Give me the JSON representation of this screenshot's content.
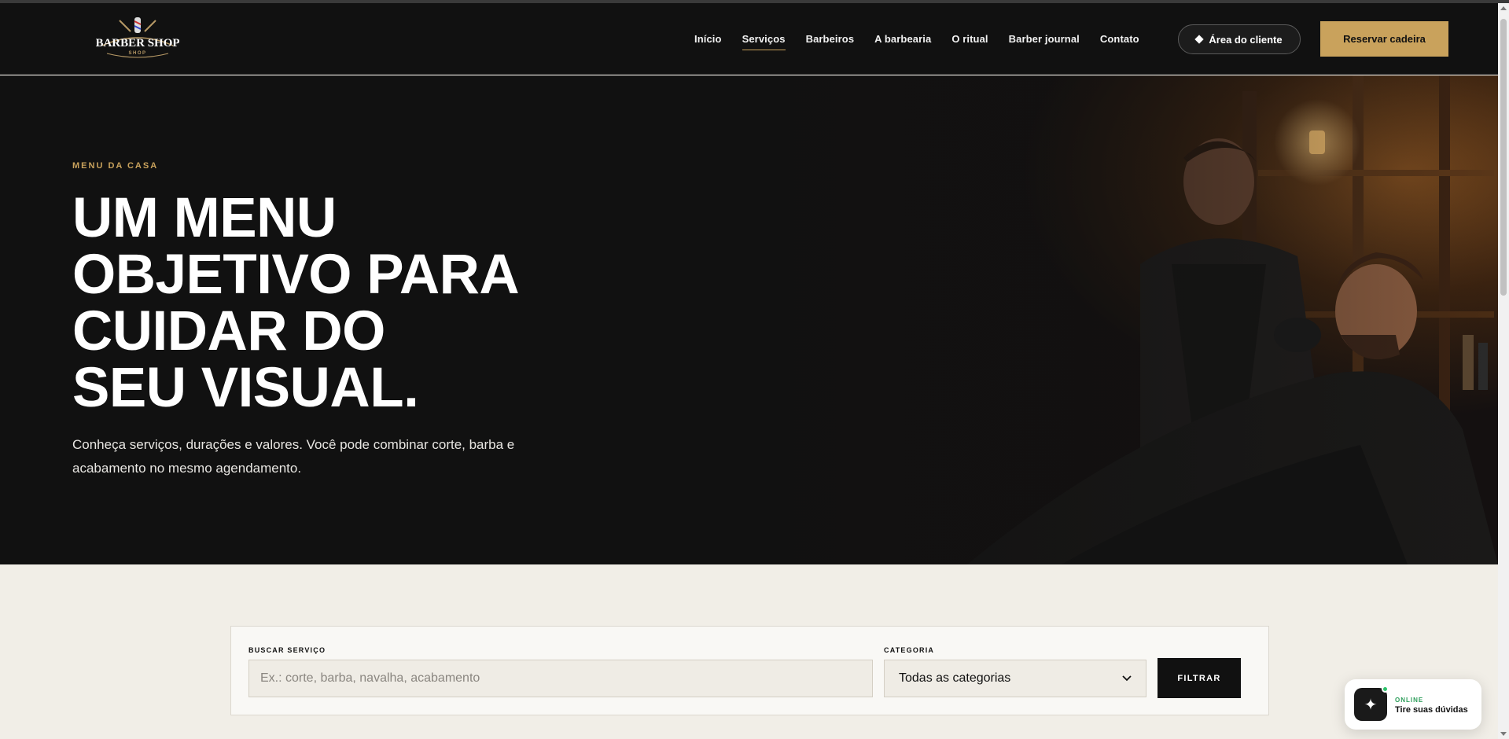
{
  "brand": {
    "logo_main": "BARBER SHOP",
    "logo_sub": "SHOP"
  },
  "nav": {
    "items": [
      {
        "label": "Início",
        "active": false
      },
      {
        "label": "Serviços",
        "active": true
      },
      {
        "label": "Barbeiros",
        "active": false
      },
      {
        "label": "A barbearia",
        "active": false
      },
      {
        "label": "O ritual",
        "active": false
      },
      {
        "label": "Barber journal",
        "active": false
      },
      {
        "label": "Contato",
        "active": false
      }
    ],
    "client_area": "Área do cliente",
    "reserve": "Reservar cadeira"
  },
  "hero": {
    "eyebrow": "MENU DA CASA",
    "headline_lines": [
      "UM MENU",
      "OBJETIVO PARA",
      "CUIDAR DO",
      "SEU VISUAL."
    ],
    "lead": "Conheça serviços, durações e valores. Você pode combinar corte, barba e acabamento no mesmo agendamento."
  },
  "filter": {
    "search_label": "BUSCAR SERVIÇO",
    "search_placeholder": "Ex.: corte, barba, navalha, acabamento",
    "search_value": "",
    "category_label": "CATEGORIA",
    "category_selected": "Todas as categorias",
    "submit": "FILTRAR"
  },
  "chat": {
    "status": "ONLINE",
    "text": "Tire suas dúvidas"
  },
  "colors": {
    "accent": "#c9a25c",
    "dark": "#111111",
    "page_bg": "#f1eee7",
    "online": "#2ec26b"
  },
  "icons": [
    "barber-shop-logo",
    "diamond-icon",
    "chevron-down-icon",
    "sparkle-icon"
  ]
}
